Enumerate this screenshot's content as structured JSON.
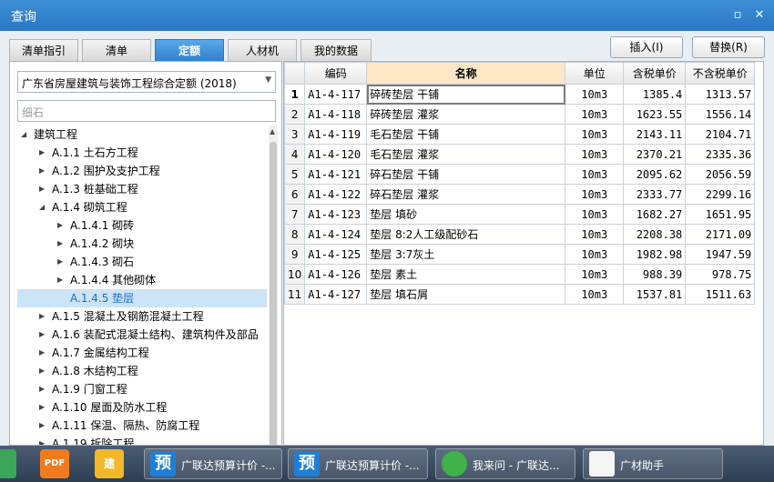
{
  "window": {
    "title": "查询"
  },
  "tabs": [
    {
      "label": "清单指引",
      "active": false
    },
    {
      "label": "清单",
      "active": false
    },
    {
      "label": "定额",
      "active": true
    },
    {
      "label": "人材机",
      "active": false
    },
    {
      "label": "我的数据",
      "active": false
    }
  ],
  "actions": {
    "insert": "插入(I)",
    "replace": "替换(R)"
  },
  "library": {
    "selected": "广东省房屋建筑与装饰工程综合定额 (2018)"
  },
  "search": {
    "value": "细石"
  },
  "tree": [
    {
      "label": "建筑工程",
      "level": 0,
      "expanded": true
    },
    {
      "label": "A.1.1 土石方工程",
      "level": 1
    },
    {
      "label": "A.1.2 围护及支护工程",
      "level": 1
    },
    {
      "label": "A.1.3 桩基础工程",
      "level": 1
    },
    {
      "label": "A.1.4 砌筑工程",
      "level": 1,
      "expanded": true
    },
    {
      "label": "A.1.4.1 砌砖",
      "level": 2
    },
    {
      "label": "A.1.4.2 砌块",
      "level": 2
    },
    {
      "label": "A.1.4.3 砌石",
      "level": 2
    },
    {
      "label": "A.1.4.4 其他砌体",
      "level": 2
    },
    {
      "label": "A.1.4.5 垫层",
      "level": 2,
      "selected": true,
      "leaf": true
    },
    {
      "label": "A.1.5 混凝土及钢筋混凝土工程",
      "level": 1
    },
    {
      "label": "A.1.6 装配式混凝土结构、建筑构件及部品",
      "level": 1
    },
    {
      "label": "A.1.7 金属结构工程",
      "level": 1
    },
    {
      "label": "A.1.8 木结构工程",
      "level": 1
    },
    {
      "label": "A.1.9 门窗工程",
      "level": 1
    },
    {
      "label": "A.1.10 屋面及防水工程",
      "level": 1
    },
    {
      "label": "A.1.11 保温、隔热、防腐工程",
      "level": 1
    },
    {
      "label": "A.1.19 拆除工程",
      "level": 1
    }
  ],
  "table": {
    "headers": [
      "",
      "编码",
      "名称",
      "单位",
      "含税单价",
      "不含税单价"
    ],
    "rows": [
      [
        "1",
        "A1-4-117",
        "碎砖垫层 干铺",
        "10m3",
        "1385.4",
        "1313.57"
      ],
      [
        "2",
        "A1-4-118",
        "碎砖垫层 灌浆",
        "10m3",
        "1623.55",
        "1556.14"
      ],
      [
        "3",
        "A1-4-119",
        "毛石垫层 干铺",
        "10m3",
        "2143.11",
        "2104.71"
      ],
      [
        "4",
        "A1-4-120",
        "毛石垫层 灌浆",
        "10m3",
        "2370.21",
        "2335.36"
      ],
      [
        "5",
        "A1-4-121",
        "碎石垫层 干铺",
        "10m3",
        "2095.62",
        "2056.59"
      ],
      [
        "6",
        "A1-4-122",
        "碎石垫层 灌浆",
        "10m3",
        "2333.77",
        "2299.16"
      ],
      [
        "7",
        "A1-4-123",
        "垫层 填砂",
        "10m3",
        "1682.27",
        "1651.95"
      ],
      [
        "8",
        "A1-4-124",
        "垫层 8:2人工级配砂石",
        "10m3",
        "2208.38",
        "2171.09"
      ],
      [
        "9",
        "A1-4-125",
        "垫层 3:7灰土",
        "10m3",
        "1982.98",
        "1947.59"
      ],
      [
        "10",
        "A1-4-126",
        "垫层 素土",
        "10m3",
        "988.39",
        "978.75"
      ],
      [
        "11",
        "A1-4-127",
        "垫层 填石屑",
        "10m3",
        "1537.81",
        "1511.63"
      ]
    ]
  },
  "taskbar": [
    {
      "label": "广联达预算计价 -...",
      "icon_text": "预"
    },
    {
      "label": "广联达预算计价 -...",
      "icon_text": "预"
    },
    {
      "label": "我来问 - 广联达...",
      "icon_text": ""
    },
    {
      "label": "广材助手",
      "icon_text": ""
    }
  ],
  "taskbar_pins": [
    {
      "label": "PDF"
    },
    {
      "label": "建"
    }
  ],
  "colors": {
    "titlebar": "#2b77c4",
    "active_tab": "#3a8be0",
    "selected_tree": "#cce4f7",
    "header_highlight": "#fde7c7"
  }
}
